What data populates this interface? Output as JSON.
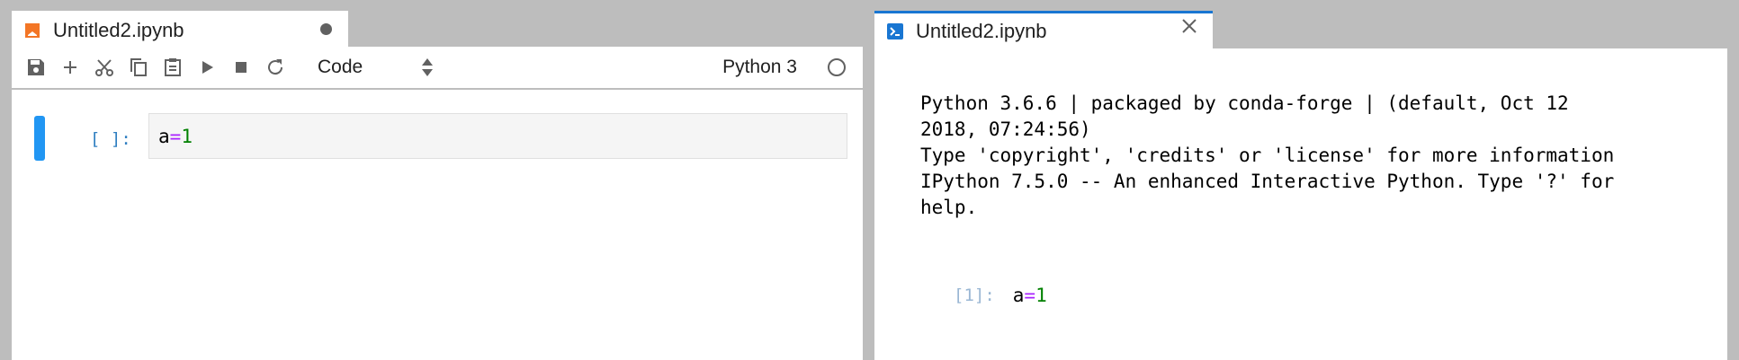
{
  "notebook": {
    "tab_title": "Untitled2.ipynb",
    "toolbar": {
      "buttons": [
        "save-icon",
        "add-icon",
        "cut-icon",
        "copy-icon",
        "paste-icon",
        "run-icon",
        "stop-icon",
        "restart-icon"
      ],
      "cell_type": "Code",
      "kernel_name": "Python 3"
    },
    "cell": {
      "prompt": "[ ]:",
      "code": {
        "var": "a",
        "op": "=",
        "num": "1"
      }
    }
  },
  "console": {
    "tab_title": "Untitled2.ipynb",
    "banner": "Python 3.6.6 | packaged by conda-forge | (default, Oct 12\n2018, 07:24:56)\nType 'copyright', 'credits' or 'license' for more information\nIPython 7.5.0 -- An enhanced Interactive Python. Type '?' for\nhelp.",
    "cell": {
      "prompt": "[1]:",
      "code": {
        "var": "a",
        "op": "=",
        "num": "1"
      }
    }
  },
  "colors": {
    "notebook_icon": "#f37626",
    "console_icon": "#1976d2",
    "active_tab_border": "#1976d2",
    "cell_collapser": "#2196f3",
    "prompt": "#307fc1"
  }
}
